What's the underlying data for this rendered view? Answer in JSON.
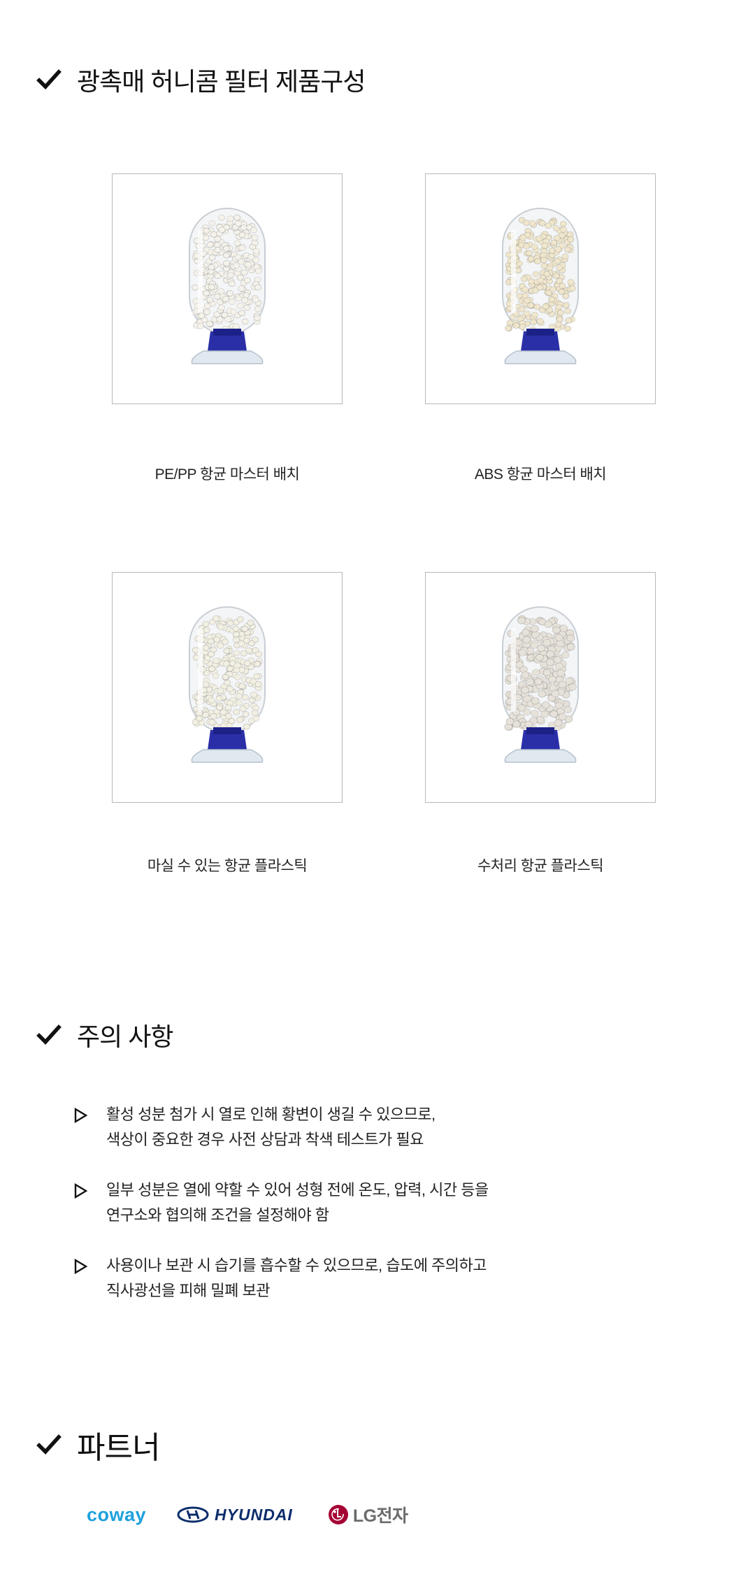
{
  "sections": {
    "composition_title": "광촉매 허니콤 필터 제품구성",
    "notice_title": "주의 사항",
    "partner_title": "파트너"
  },
  "products": [
    {
      "caption": "PE/PP 항균 마스터 배치",
      "pellet_color": "#f4f2ea"
    },
    {
      "caption": "ABS 항균 마스터 배치",
      "pellet_color": "#efe6cd"
    },
    {
      "caption": "마실 수 있는 항균 플라스틱",
      "pellet_color": "#f2efe3"
    },
    {
      "caption": "수처리 항균 플라스틱",
      "pellet_color": "#e6e2da"
    }
  ],
  "notices": [
    {
      "line1": "활성 성분 첨가 시 열로 인해 황변이 생길 수 있으므로,",
      "line2": "색상이 중요한 경우 사전 상담과 착색 테스트가 필요"
    },
    {
      "line1": "일부 성분은 열에 약할 수 있어 성형 전에 온도, 압력, 시간 등을",
      "line2": "연구소와 협의해 조건을 설정해야 함"
    },
    {
      "line1": "사용이나 보관 시 습기를 흡수할 수 있으므로, 습도에 주의하고",
      "line2": "직사광선을 피해 밀폐 보관"
    }
  ],
  "partners": {
    "coway": "coway",
    "hyundai": "HYUNDAI",
    "lg": "LG전자"
  },
  "colors": {
    "coway_blue": "#1ea1dc",
    "hyundai_navy": "#0c2d6b",
    "lg_red": "#a50034",
    "jar_cap_blue": "#2a2fa8"
  }
}
